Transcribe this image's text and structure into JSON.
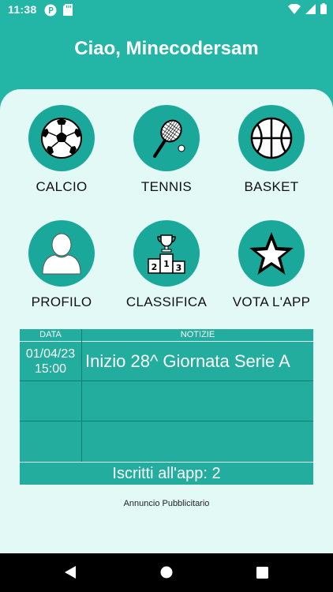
{
  "status_bar": {
    "time": "11:38",
    "icons": [
      "p-circle-icon",
      "sd-card-icon",
      "wifi-icon",
      "signal-icon",
      "battery-icon"
    ]
  },
  "header": {
    "greeting": "Ciao, Minecodersam"
  },
  "tiles": [
    {
      "label": "CALCIO",
      "icon": "soccer-ball-icon"
    },
    {
      "label": "TENNIS",
      "icon": "tennis-racket-icon"
    },
    {
      "label": "BASKET",
      "icon": "basketball-icon"
    },
    {
      "label": "PROFILO",
      "icon": "user-icon"
    },
    {
      "label": "CLASSIFICA",
      "icon": "podium-icon"
    },
    {
      "label": "VOTA L'APP",
      "icon": "star-icon"
    }
  ],
  "news": {
    "headers": {
      "date": "DATA",
      "news": "NOTIZIE"
    },
    "rows": [
      {
        "date": "01/04/23",
        "time": "15:00",
        "text": "Inizio 28^ Giornata Serie A"
      }
    ],
    "subscribers": "Iscritti all'app: 2"
  },
  "ad_label": "Annuncio Pubblicitario",
  "colors": {
    "primary": "#23b5a6",
    "tile": "#1aa89a",
    "background": "#e3f9f6",
    "table": "#22ad9e"
  },
  "nav": [
    "back-icon",
    "home-icon",
    "recents-icon"
  ]
}
